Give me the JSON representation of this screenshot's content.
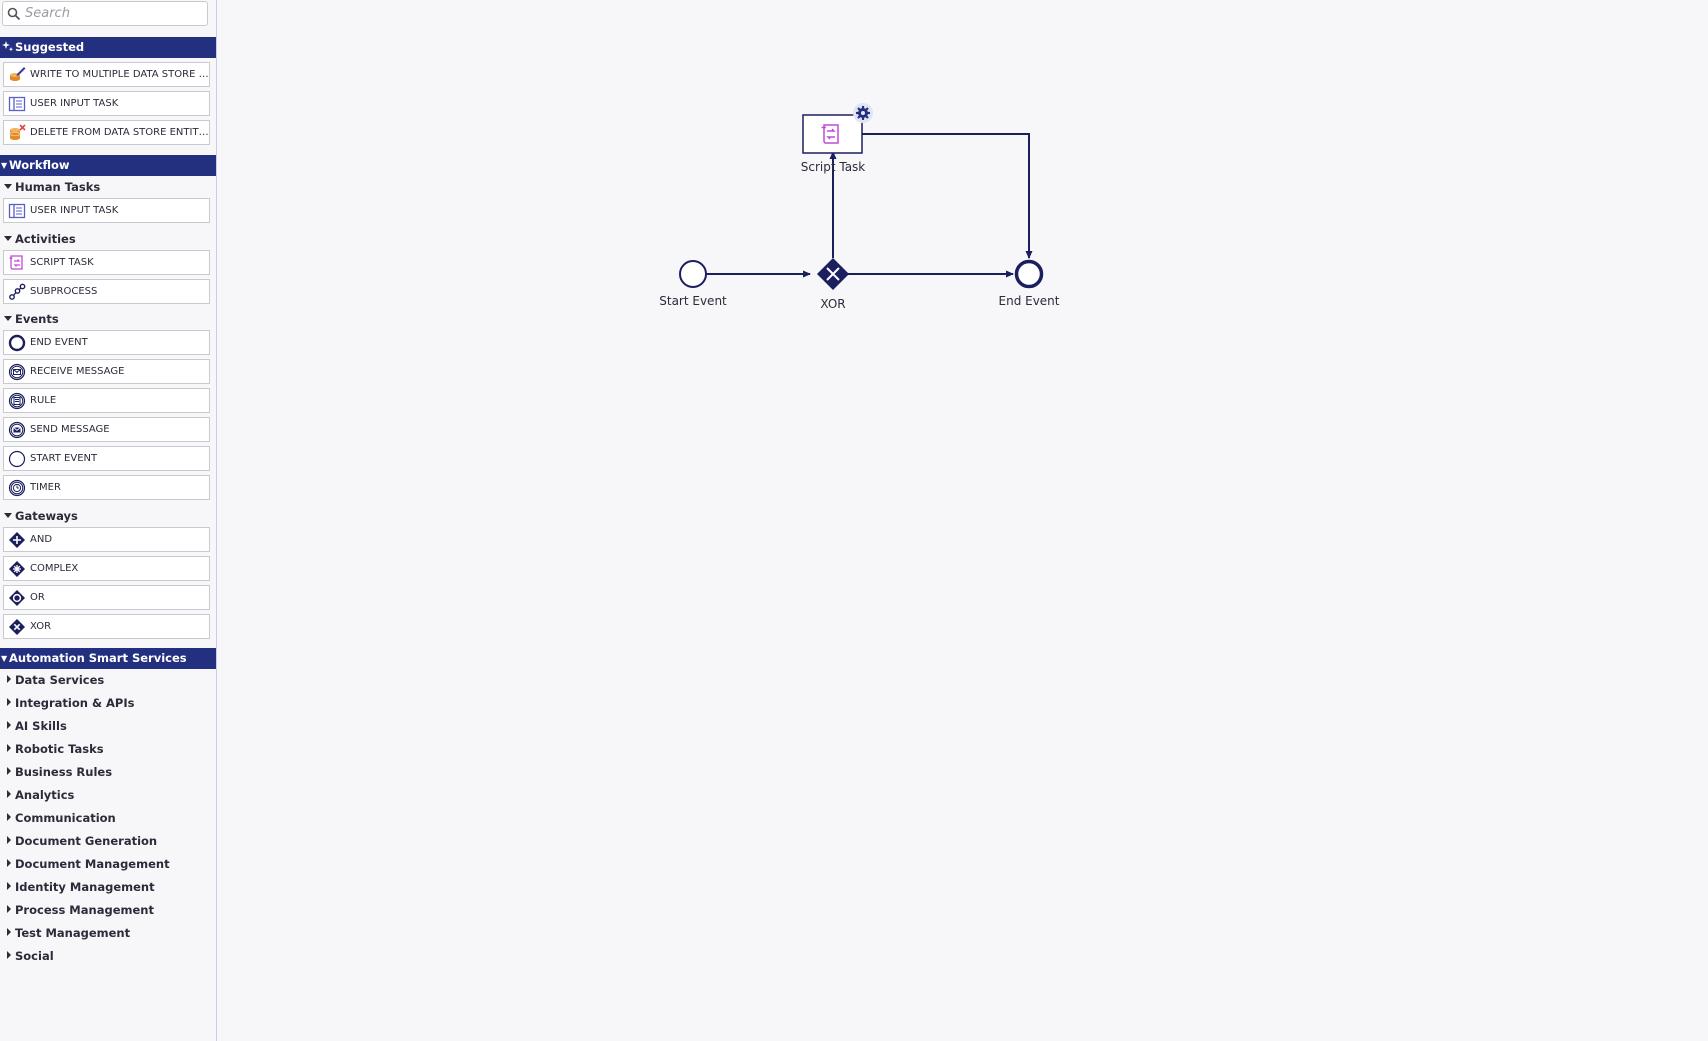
{
  "search": {
    "placeholder": "Search"
  },
  "suggested": {
    "title": "Suggested",
    "items": [
      {
        "label": "WRITE TO MULTIPLE DATA STORE E...",
        "icon": "data-store-write-icon"
      },
      {
        "label": "USER INPUT TASK",
        "icon": "user-input-task-icon"
      },
      {
        "label": "DELETE FROM DATA STORE ENTITIES",
        "icon": "data-store-delete-icon"
      }
    ]
  },
  "workflow": {
    "title": "Workflow",
    "human_tasks": {
      "title": "Human Tasks",
      "items": [
        {
          "label": "USER INPUT TASK",
          "icon": "user-input-task-icon"
        }
      ]
    },
    "activities": {
      "title": "Activities",
      "items": [
        {
          "label": "SCRIPT TASK",
          "icon": "script-task-icon"
        },
        {
          "label": "SUBPROCESS",
          "icon": "subprocess-icon"
        }
      ]
    },
    "events": {
      "title": "Events",
      "items": [
        {
          "label": "END EVENT",
          "icon": "end-event-icon"
        },
        {
          "label": "RECEIVE MESSAGE",
          "icon": "receive-message-icon"
        },
        {
          "label": "RULE",
          "icon": "rule-icon"
        },
        {
          "label": "SEND MESSAGE",
          "icon": "send-message-icon"
        },
        {
          "label": "START EVENT",
          "icon": "start-event-icon"
        },
        {
          "label": "TIMER",
          "icon": "timer-icon"
        }
      ]
    },
    "gateways": {
      "title": "Gateways",
      "items": [
        {
          "label": "AND",
          "icon": "and-gateway-icon"
        },
        {
          "label": "COMPLEX",
          "icon": "complex-gateway-icon"
        },
        {
          "label": "OR",
          "icon": "or-gateway-icon"
        },
        {
          "label": "XOR",
          "icon": "xor-gateway-icon"
        }
      ]
    }
  },
  "automation": {
    "title": "Automation Smart Services",
    "categories": [
      "Data Services",
      "Integration & APIs",
      "AI Skills",
      "Robotic Tasks",
      "Business Rules",
      "Analytics",
      "Communication",
      "Document Generation",
      "Document Management",
      "Identity Management",
      "Process Management",
      "Test Management",
      "Social"
    ]
  },
  "diagram": {
    "start_label": "Start Event",
    "xor_label": "XOR",
    "end_label": "End Event",
    "script_label": "Script Task",
    "settings_icon": "gear-icon"
  },
  "colors": {
    "brand": "#233080",
    "node": "#1b1f5e",
    "script_accent": "#c04bd8",
    "canvas": "#f7f7fa"
  }
}
